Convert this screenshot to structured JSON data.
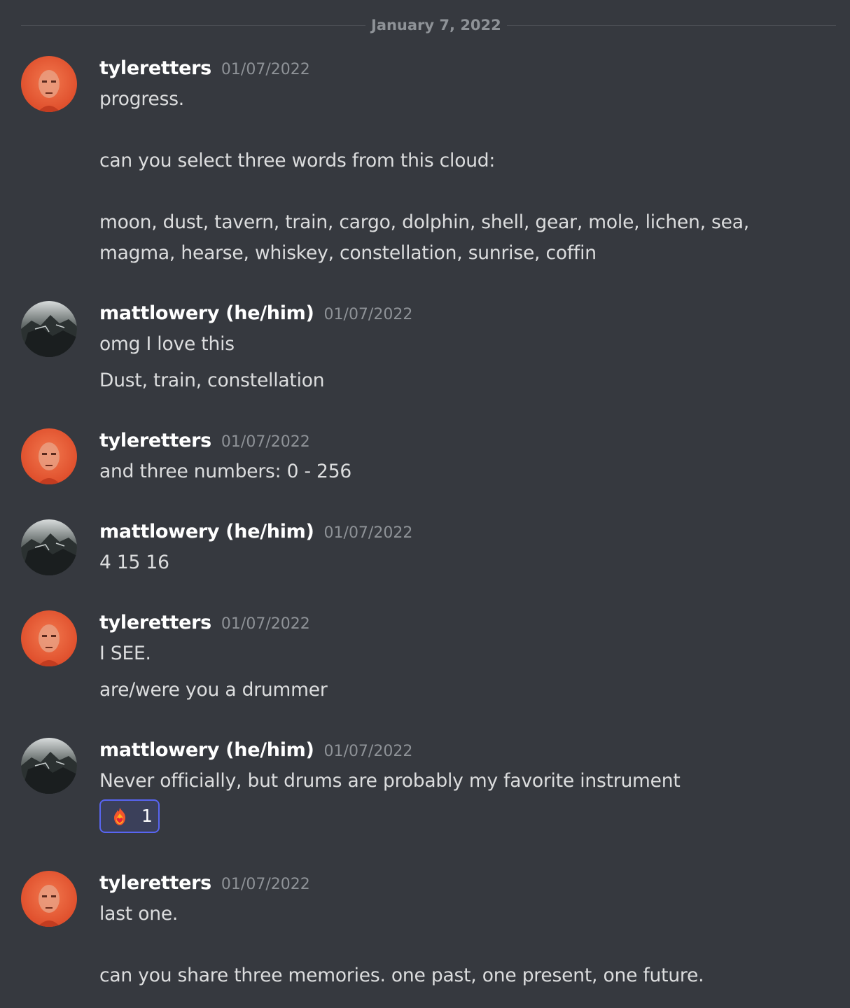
{
  "date_divider": "January 7, 2022",
  "messages": [
    {
      "username": "tyleretters",
      "timestamp": "01/07/2022",
      "lines": [
        "progress.",
        "can you select three words from this cloud:",
        "moon, dust, tavern, train, cargo, dolphin, shell, gear, mole, lichen, sea,",
        "magma, hearse, whiskey, constellation, sunrise, coffin"
      ]
    },
    {
      "username": "mattlowery (he/him)",
      "timestamp": "01/07/2022",
      "lines": [
        "omg I love this",
        "Dust, train, constellation"
      ]
    },
    {
      "username": "tyleretters",
      "timestamp": "01/07/2022",
      "lines": [
        "and three numbers: 0 - 256"
      ]
    },
    {
      "username": "mattlowery (he/him)",
      "timestamp": "01/07/2022",
      "lines": [
        "4 15 16"
      ]
    },
    {
      "username": "tyleretters",
      "timestamp": "01/07/2022",
      "lines": [
        "I SEE.",
        "are/were you a drummer"
      ]
    },
    {
      "username": "mattlowery (he/him)",
      "timestamp": "01/07/2022",
      "lines": [
        "Never officially, but drums are probably my favorite instrument"
      ],
      "reaction": {
        "emoji": "fire-heart-icon",
        "count": "1"
      }
    },
    {
      "username": "tyleretters",
      "timestamp": "01/07/2022",
      "lines": [
        "last one.",
        "can you share three memories. one past, one present, one future."
      ]
    }
  ],
  "colors": {
    "background": "#36393f",
    "username": "#ffffff",
    "timestamp": "#8e9297",
    "text": "#dcddde",
    "reaction_border": "#5865f2"
  }
}
